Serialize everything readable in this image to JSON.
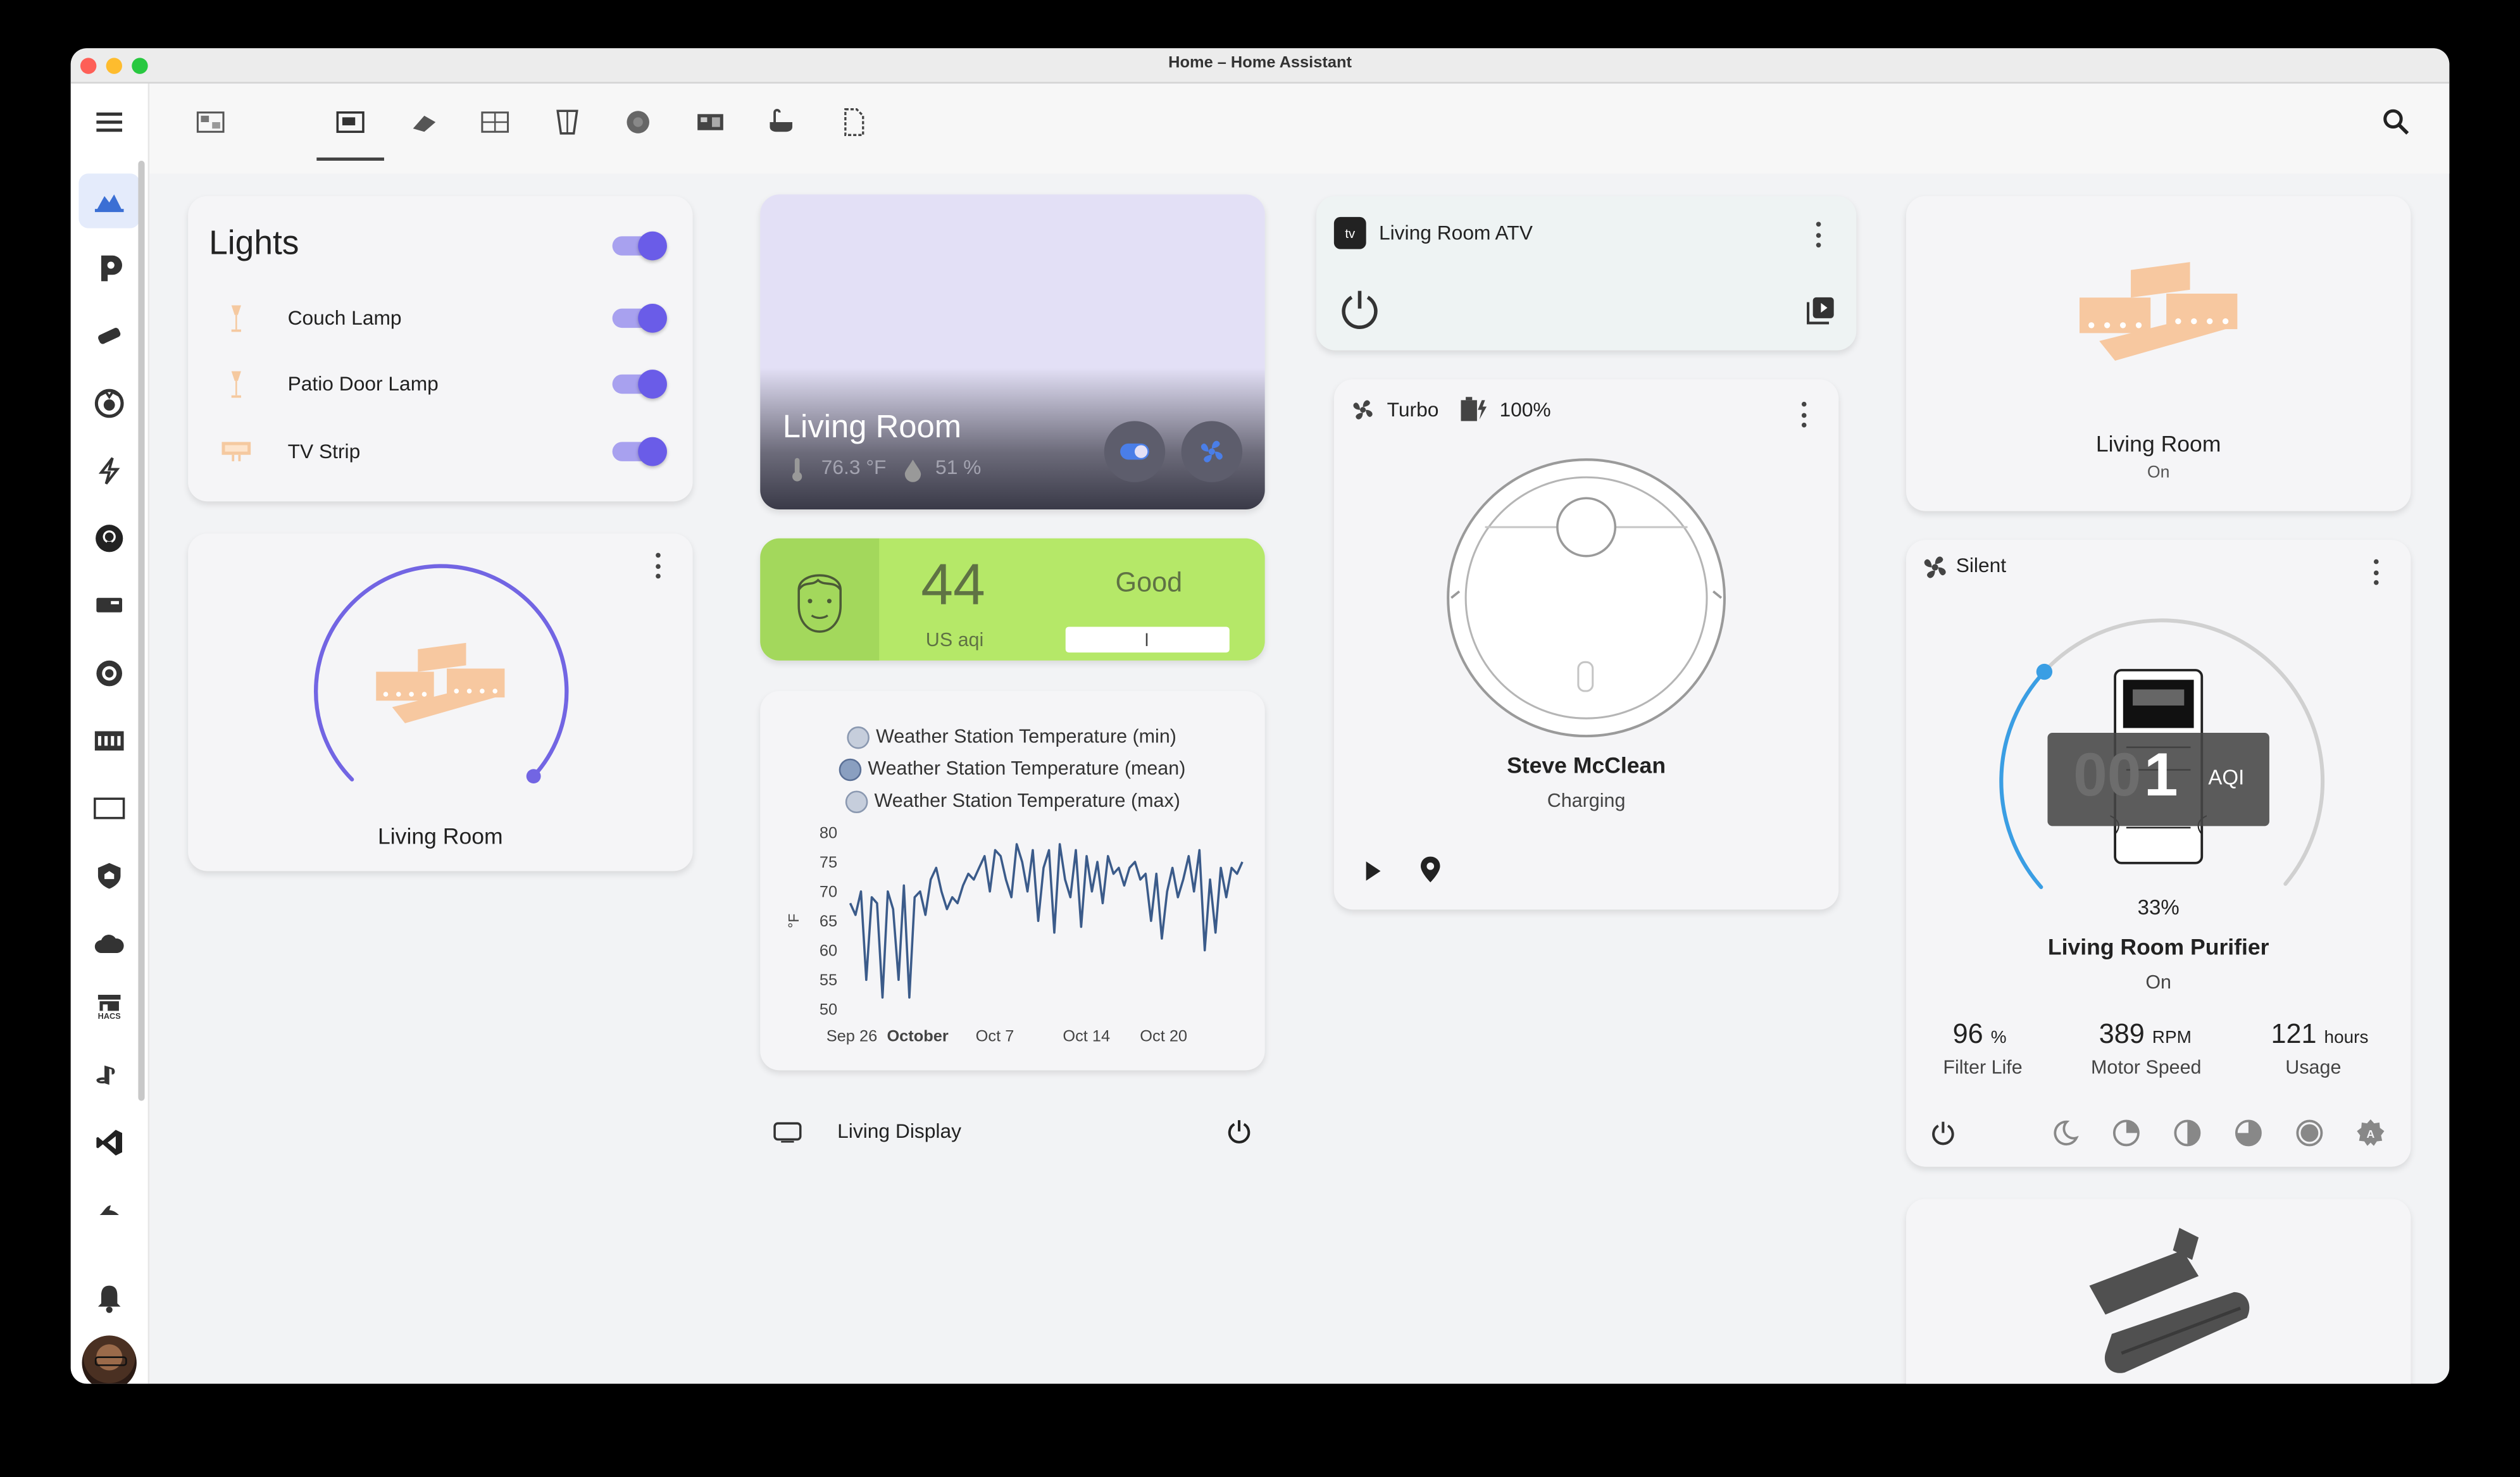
{
  "window": {
    "title": "Home – Home Assistant"
  },
  "sidebar": {
    "items": [
      {
        "icon": "home-dashboard-icon"
      },
      {
        "icon": "plex-icon"
      },
      {
        "icon": "telescope-icon"
      },
      {
        "icon": "spooky-eye-icon"
      },
      {
        "icon": "lightning-icon"
      },
      {
        "icon": "github-icon"
      },
      {
        "icon": "tv-box-icon"
      },
      {
        "icon": "record-icon"
      },
      {
        "icon": "keyboard-icon"
      },
      {
        "icon": "rectangle-icon"
      },
      {
        "icon": "shield-home-icon"
      },
      {
        "icon": "cloud-icon"
      },
      {
        "icon": "hacs-icon",
        "label": "HACS"
      },
      {
        "icon": "playstation-icon"
      },
      {
        "icon": "vscode-icon"
      },
      {
        "icon": "shark-icon"
      }
    ],
    "notifications_icon": "bell-icon",
    "avatar": "user-avatar"
  },
  "topbar": {
    "views": [
      "home-view",
      "living-room-view",
      "bedroom-view",
      "office-view",
      "hallway-view",
      "cameras-view",
      "kitchen-view",
      "bathroom-view",
      "file-view"
    ],
    "search_icon": "search-icon",
    "menu_icon": "more-vert-icon"
  },
  "lights": {
    "title": "Lights",
    "items": [
      {
        "label": "Couch Lamp"
      },
      {
        "label": "Patio Door Lamp"
      },
      {
        "label": "TV Strip"
      }
    ]
  },
  "living_room_light": {
    "name": "Living Room",
    "brightness_ring": 0.78
  },
  "room_card": {
    "name": "Living Room",
    "temperature": "76.3 °F",
    "humidity": "51 %",
    "gradient_top": "#e3e0f6"
  },
  "aqi": {
    "value": "44",
    "unit": "US aqi",
    "status": "Good",
    "color": "#a6e05f"
  },
  "chart_data": {
    "type": "line",
    "legend": [
      "Weather Station Temperature (min)",
      "Weather Station Temperature (mean)",
      "Weather Station Temperature (max)"
    ],
    "ylabel": "°F",
    "yticks": [
      "80",
      "75",
      "70",
      "65",
      "60",
      "55",
      "50"
    ],
    "xticks": [
      "Sep 26",
      "October",
      "Oct 7",
      "Oct 14",
      "Oct 20"
    ],
    "ylim": [
      50,
      80
    ],
    "series": [
      {
        "name": "Weather Station Temperature (mean)",
        "color": "#3b5b8a",
        "values": [
          68,
          66,
          70,
          55,
          69,
          68,
          52,
          70,
          67,
          55,
          71,
          52,
          69,
          70,
          66,
          72,
          74,
          70,
          67,
          69,
          68,
          71,
          73,
          72,
          74,
          76,
          70,
          77,
          76,
          72,
          69,
          78,
          75,
          70,
          77,
          65,
          74,
          77,
          63,
          78,
          72,
          69,
          77,
          64,
          76,
          70,
          75,
          68,
          76,
          73,
          74,
          71,
          74,
          75,
          72,
          73,
          65,
          73,
          62,
          70,
          74,
          69,
          72,
          76,
          70,
          77,
          60,
          72,
          63,
          74,
          69,
          74,
          73,
          75
        ]
      }
    ]
  },
  "living_display": {
    "name": "Living Display"
  },
  "atv": {
    "name": "Living Room ATV",
    "badge": "tv"
  },
  "vacuum": {
    "fan_mode": "Turbo",
    "battery": "100%",
    "name": "Steve McClean",
    "status": "Charging"
  },
  "living_room_tile": {
    "name": "Living Room",
    "state": "On"
  },
  "purifier": {
    "mode": "Silent",
    "aqi": "1",
    "aqi_ghost": "00",
    "aqi_unit": "AQI",
    "percentage_label": "33%",
    "percentage": 0.33,
    "name": "Living Room Purifier",
    "state": "On",
    "stats": [
      {
        "value": "96",
        "unit": "%",
        "label": "Filter Life"
      },
      {
        "value": "389",
        "unit": "RPM",
        "label": "Motor Speed"
      },
      {
        "value": "121",
        "unit": "hours",
        "label": "Usage"
      }
    ]
  },
  "colors": {
    "accent": "#6a5ce8",
    "light_icon": "#f5c9a0",
    "purifier_arc": "#3a9ee4"
  }
}
